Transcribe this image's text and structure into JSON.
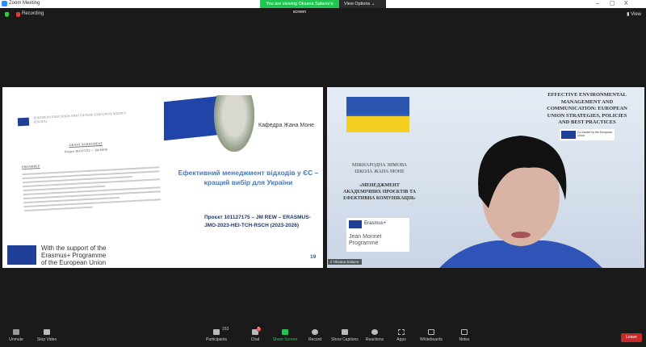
{
  "window": {
    "title": "Zoom Meeting",
    "banner": "You are viewing Oksana Salavor's screen",
    "view_options": "View Options",
    "minimize": "–",
    "restore": "▢",
    "close": "X"
  },
  "topbar": {
    "recording": "Recording",
    "view": "View"
  },
  "slide": {
    "doc_agency": "EUROPEAN EDUCATION AND CULTURE EXECUTIVE AGENCY (EACEA)",
    "doc_title": "GRANT AGREEMENT",
    "doc_project": "Project 101127175 — JM REW",
    "doc_preamble": "PREAMBLE",
    "support": [
      "With the support of the",
      "Erasmus+ Programme",
      "of the European Union"
    ],
    "kafedra": "Кафедра Жана Моне",
    "title": "Ефективний менеджмент відходів у ЄС – кращий вибір для України",
    "project": [
      "Проєкт 101127175 – JM REW – ERASMUS-",
      "JMO-2023-HEI-TCH-RSCH (2023-2026)"
    ],
    "page_number": "19"
  },
  "video": {
    "event_title": [
      "EFFECTIVE ENVIRONMENTAL",
      "MANAGEMENT AND",
      "COMMUNICATION: EUROPEAN",
      "UNION  STRATEGIES, POLICIES",
      "AND BEST PRACTICES"
    ],
    "cofunded": "Co-funded by the European Union",
    "school": [
      "МІЖНАРОДНА ЗИМОВА",
      "ШКОЛА ЖАНА МОНЕ"
    ],
    "course": [
      "«МЕНЕДЖМЕНТ",
      "АКАДЕМІЧНИХ ПРОЄКТІВ ТА",
      "ЕФЕКТИВНА КОМУНІКАЦІЯ»"
    ],
    "erasmus": "Erasmus+",
    "jean_monnet": [
      "Jean Monnet",
      "Programme"
    ],
    "participant_name": "Oksana Salavor"
  },
  "toolbar": {
    "unmute": "Unmute",
    "stop_video": "Stop Video",
    "participants": "Participants",
    "participants_count": "153",
    "chat": "Chat",
    "chat_badge": "5",
    "share_screen": "Share Screen",
    "record": "Record",
    "show_captions": "Show Captions",
    "reactions": "Reactions",
    "apps": "Apps",
    "whiteboards": "Whiteboards",
    "notes": "Notes",
    "leave": "Leave"
  },
  "colors": {
    "share_green": "#23c552",
    "leave_red": "#c82a2a",
    "zoom_blue": "#2d8cff"
  }
}
